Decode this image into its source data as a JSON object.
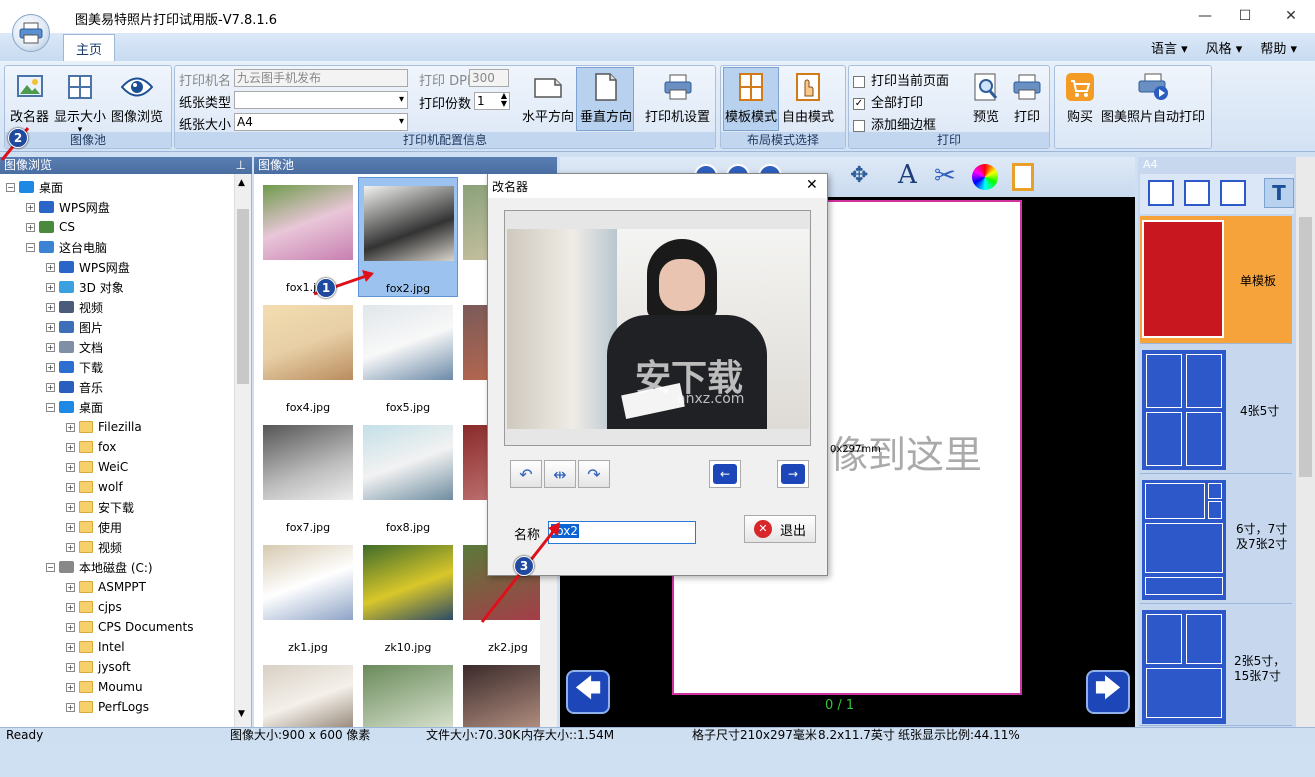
{
  "window": {
    "title": "图美易特照片打印试用版-V7.8.1.6",
    "minimize": "—",
    "maximize": "☐",
    "close": "✕"
  },
  "tabs": {
    "home": "主页"
  },
  "top_links": [
    "语言",
    "风格",
    "帮助"
  ],
  "ribbon": {
    "image_pool": {
      "label": "图像池",
      "rename": "改名器",
      "display_size": "显示大小",
      "browse": "图像浏览"
    },
    "printer_config": {
      "label": "打印机配置信息",
      "printer_name_label": "打印机名",
      "printer_name_value": "九云图手机发布",
      "paper_type_label": "纸张类型",
      "paper_type_value": "",
      "paper_size_label": "纸张大小",
      "paper_size_value": "A4",
      "dpi_label": "打印 DPI",
      "dpi_value": "300",
      "copies_label": "打印份数",
      "copies_value": "1",
      "landscape": "水平方向",
      "portrait": "垂直方向",
      "printer_settings": "打印机设置"
    },
    "layout_mode": {
      "label": "布局模式选择",
      "template": "模板模式",
      "free": "自由模式"
    },
    "print": {
      "label": "打印",
      "current_page": "打印当前页面",
      "all": "全部打印",
      "border": "添加细边框",
      "preview": "预览",
      "print": "打印"
    },
    "buy": "购买",
    "auto_print": "图美照片自动打印"
  },
  "tree": {
    "header": "图像浏览",
    "items": [
      {
        "label": "桌面",
        "level": 0,
        "icon": "desktop"
      },
      {
        "label": "WPS网盘",
        "level": 1,
        "icon": "cloud"
      },
      {
        "label": "CS",
        "level": 1,
        "icon": "user"
      },
      {
        "label": "这台电脑",
        "level": 1,
        "icon": "pc"
      },
      {
        "label": "WPS网盘",
        "level": 2,
        "icon": "cloud"
      },
      {
        "label": "3D 对象",
        "level": 2,
        "icon": "cube"
      },
      {
        "label": "视频",
        "level": 2,
        "icon": "video"
      },
      {
        "label": "图片",
        "level": 2,
        "icon": "picture"
      },
      {
        "label": "文档",
        "level": 2,
        "icon": "doc"
      },
      {
        "label": "下载",
        "level": 2,
        "icon": "download"
      },
      {
        "label": "音乐",
        "level": 2,
        "icon": "music"
      },
      {
        "label": "桌面",
        "level": 2,
        "icon": "desktop"
      },
      {
        "label": "Filezilla",
        "level": 3,
        "icon": "folder"
      },
      {
        "label": "fox",
        "level": 3,
        "icon": "folder"
      },
      {
        "label": "WeiC",
        "level": 3,
        "icon": "folder"
      },
      {
        "label": "wolf",
        "level": 3,
        "icon": "folder"
      },
      {
        "label": "安下载",
        "level": 3,
        "icon": "folder"
      },
      {
        "label": "使用",
        "level": 3,
        "icon": "folder"
      },
      {
        "label": "视频",
        "level": 3,
        "icon": "folder"
      },
      {
        "label": "本地磁盘 (C:)",
        "level": 2,
        "icon": "drive"
      },
      {
        "label": "ASMPPT",
        "level": 3,
        "icon": "folder"
      },
      {
        "label": "cjps",
        "level": 3,
        "icon": "folder"
      },
      {
        "label": "CPS Documents",
        "level": 3,
        "icon": "folder"
      },
      {
        "label": "Intel",
        "level": 3,
        "icon": "folder"
      },
      {
        "label": "jysoft",
        "level": 3,
        "icon": "folder"
      },
      {
        "label": "Moumu",
        "level": 3,
        "icon": "folder"
      },
      {
        "label": "PerfLogs",
        "level": 3,
        "icon": "folder"
      }
    ]
  },
  "gallery": {
    "header": "图像池",
    "items": [
      "fox1.jpg",
      "fox2.jpg",
      "",
      "fox4.jpg",
      "fox5.jpg",
      "",
      "fox7.jpg",
      "fox8.jpg",
      "",
      "zk1.jpg",
      "zk10.jpg",
      "zk2.jpg",
      "",
      "",
      ""
    ]
  },
  "canvas": {
    "watermark": "像到这里",
    "size_text": "0x297mm",
    "page_counter": "0 / 1"
  },
  "right_panel": {
    "header": "A4",
    "templates": [
      "单模板",
      "4张5寸",
      "6寸，7寸及7张2寸",
      "2张5寸，15张7寸"
    ]
  },
  "dialog": {
    "title": "改名器",
    "close": "✕",
    "name_label": "名称",
    "name_value": "fox2",
    "exit": "退出"
  },
  "callouts": [
    "1",
    "2",
    "3"
  ],
  "status": {
    "ready": "Ready",
    "image_size": "图像大小:900 x 600 像素",
    "file_size": "文件大小:70.30K",
    "memory": "内存大小::1.54M",
    "grid_size": "格子尺寸210x297毫米",
    "grid_inch": "8.2x11.7英寸",
    "ratio": "纸张显示比例:44.11%"
  },
  "watermark_text": "安下载",
  "watermark_sub": "anxz.com",
  "colors": {
    "ribbon": "#d3e2f4",
    "selected": "#9cc3f0",
    "template_red": "#c8171e",
    "template_blue": "#2d58c9",
    "template_orange": "#f7a33c"
  }
}
